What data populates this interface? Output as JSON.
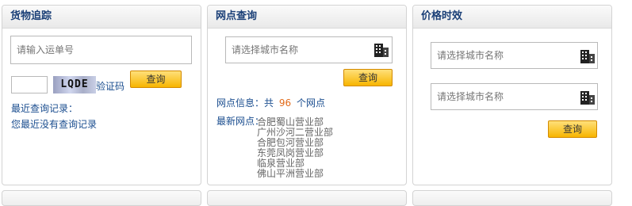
{
  "panels": {
    "tracking": {
      "title": "货物追踪",
      "waybill_placeholder": "请输入运单号",
      "captcha_value": "",
      "captcha_image_text": "LQDE",
      "captcha_link": "验证码",
      "query_button": "查询",
      "recent_label": "最近查询记录：",
      "recent_empty": "您最近没有查询记录"
    },
    "branches": {
      "title": "网点查询",
      "city_placeholder": "请选择城市名称",
      "query_button": "查询",
      "info_prefix": "网点信息：共",
      "info_count": "96",
      "info_suffix": "个网点",
      "latest_label": "最新网点：",
      "latest_items": [
        "合肥蜀山营业部",
        "广州沙河二营业部",
        "合肥包河营业部",
        "东莞凤岗营业部",
        "临泉营业部",
        "佛山平洲营业部"
      ]
    },
    "pricing": {
      "title": "价格时效",
      "from_placeholder": "请选择城市名称",
      "to_placeholder": "请选择城市名称",
      "query_button": "查询"
    }
  },
  "colors": {
    "header_text": "#1a3f77",
    "link": "#1a4d8f",
    "count_highlight": "#e26b1a",
    "button_top": "#ffe07a",
    "button_bottom": "#f7b500"
  },
  "icons": {
    "city_picker": "building-icon"
  }
}
